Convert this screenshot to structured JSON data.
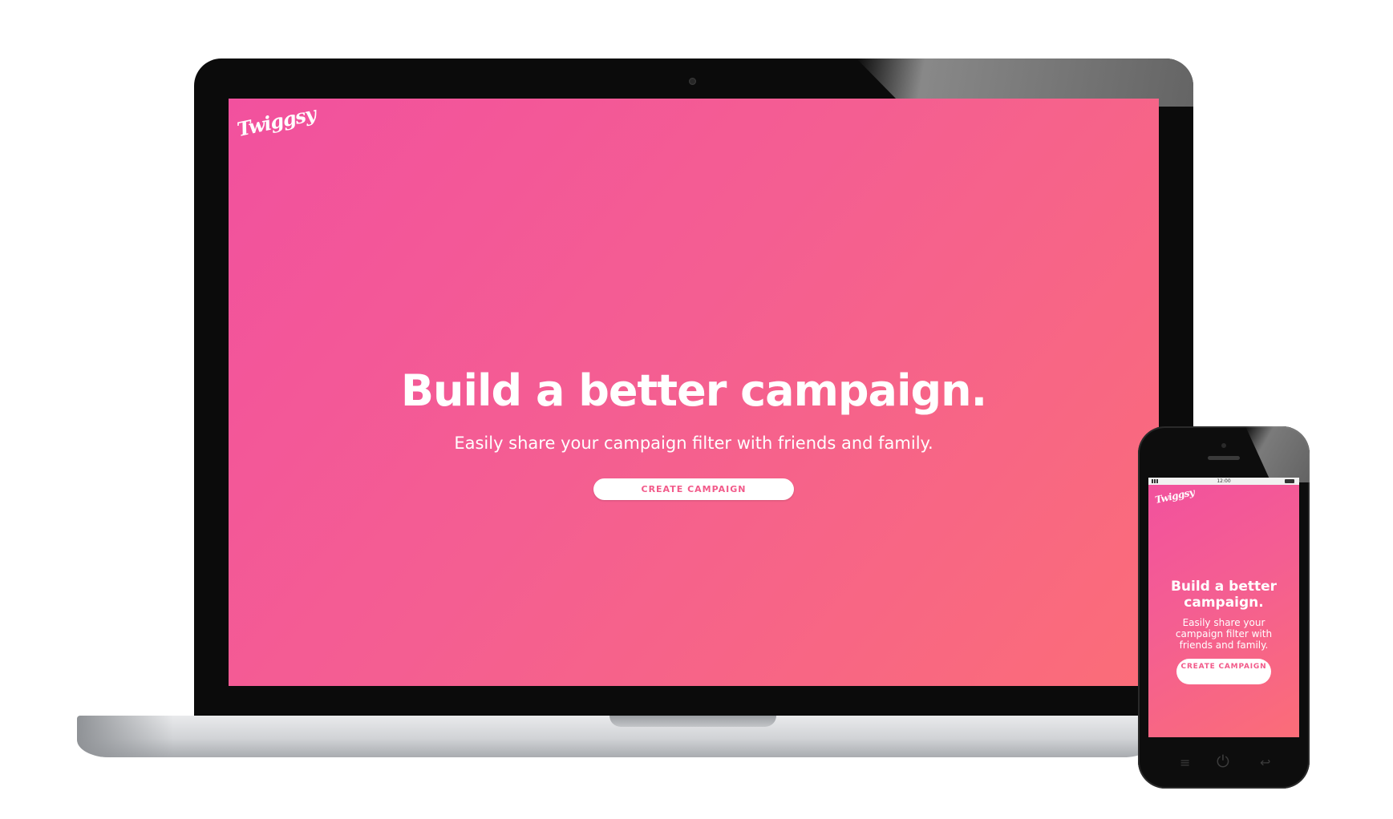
{
  "laptop": {
    "logo": "Twiggsy",
    "headline": "Build a better campaign.",
    "subhead": "Easily share your campaign filter with friends and family.",
    "cta_label": "CREATE CAMPAIGN"
  },
  "phone": {
    "status": {
      "time": "12:00"
    },
    "logo": "Twiggsy",
    "headline": "Build a better campaign.",
    "subhead": "Easily share your campaign filter with friends and family.",
    "cta_label": "CREATE CAMPAIGN",
    "nav": {
      "menu_glyph": "≡",
      "power_glyph": "⏻",
      "back_glyph": "↩"
    }
  },
  "colors": {
    "gradient_start": "#f2519e",
    "gradient_end": "#fb6d78",
    "cta_text": "#f25a8a",
    "device_frame": "#0b0b0b"
  },
  "icons": [
    "camera-icon",
    "signal-icon",
    "battery-icon",
    "menu-icon",
    "power-icon",
    "back-icon"
  ]
}
